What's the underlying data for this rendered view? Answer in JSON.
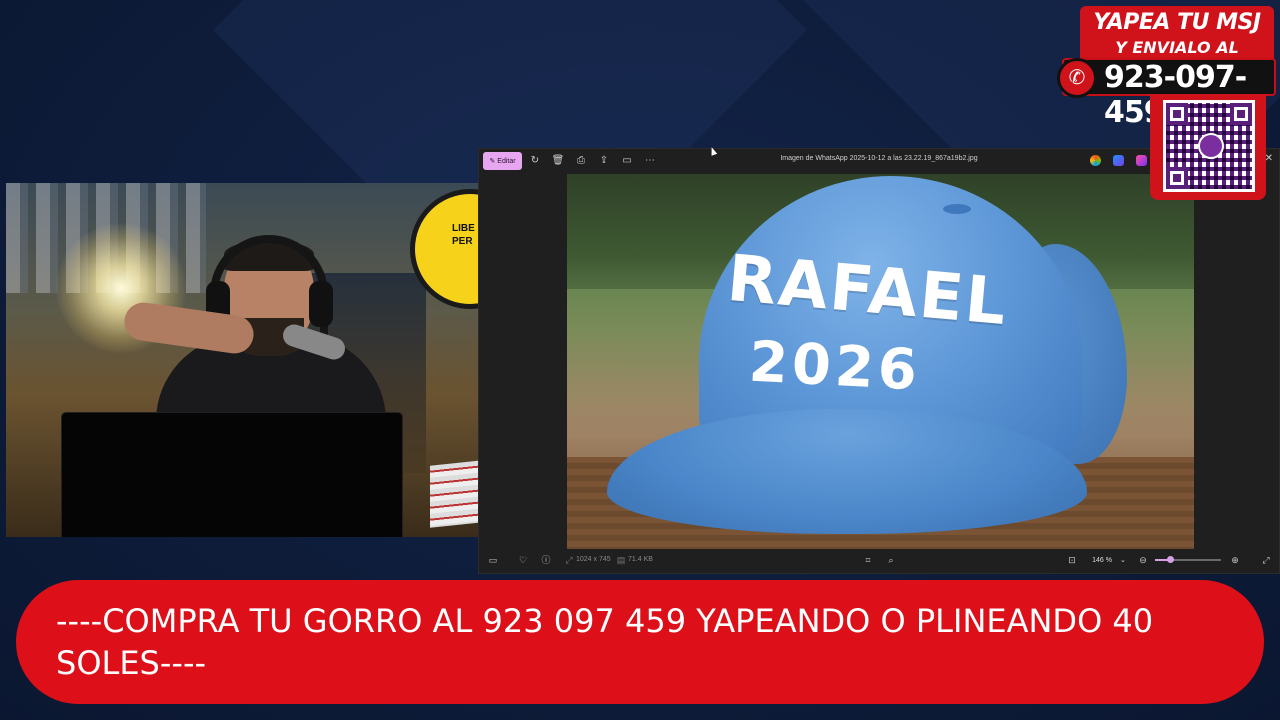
{
  "colors": {
    "background": "#0f1e3d",
    "accent_red": "#dd1019",
    "edit_button": "#e6a7f0",
    "viewer_bg": "#1f1f1f",
    "cap_blue": "#5f98d8"
  },
  "webcam": {
    "logo_text_line1": "LIBE",
    "logo_text_line2": "PER"
  },
  "viewer": {
    "edit_label": "Editar",
    "filename": "Imagen de WhatsApp 2025-10-12 a las 23.22.19_867a19b2.jpg",
    "toolbar_icons": [
      "rotate-icon",
      "delete-icon",
      "print-icon",
      "share-icon",
      "slideshow-icon",
      "more-icon"
    ],
    "app_icons": [
      "copilot-icon",
      "designer-icon",
      "clipchamp-icon"
    ],
    "photo": {
      "cap_line1": "RAFAEL",
      "cap_line2": "2026"
    },
    "status": {
      "dimensions": "1024 x 745",
      "file_size": "71.4 KB",
      "zoom": "146 %"
    }
  },
  "promo": {
    "line1": "YAPEA TU MSJ",
    "line2": "Y ENVIALO AL",
    "phone": "923-097-459"
  },
  "ticker": {
    "text": "----COMPRA TU GORRO AL 923 097 459 YAPEANDO O PLINEANDO 40 SOLES----"
  }
}
